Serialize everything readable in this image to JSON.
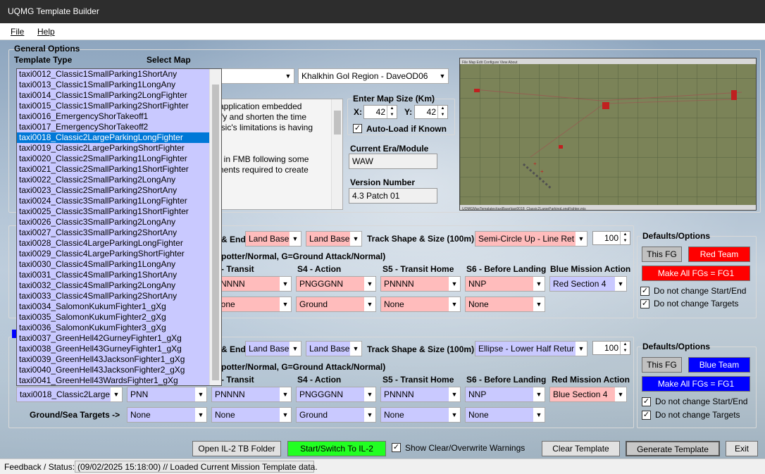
{
  "window": {
    "title": "UQMG Template Builder"
  },
  "menu": {
    "file": "File",
    "help": "Help"
  },
  "general": {
    "group_label": "General Options",
    "template_type_label": "Template Type",
    "select_map_label": "Select Map",
    "map_value": "Khalkhin Gol Region - DaveOD06",
    "desc_lines": [
      "e application embedded",
      "plify and shorten the time",
      "assic's limitations is having",
      "",
      "",
      "on in FMB following some",
      "ements required to create"
    ],
    "map_size_label": "Enter Map Size (Km)",
    "x_label": "X:",
    "x_value": "42",
    "y_label": "Y:",
    "y_value": "42",
    "autoload_label": "Auto-Load if Known",
    "era_label": "Current Era/Module",
    "era_value": "WAW",
    "version_label": "Version Number",
    "version_value": "4.3 Patch 01"
  },
  "dropdown": {
    "selected_index": 6,
    "items": [
      "taxi0012_Classic1SmallParking1ShortAny",
      "taxi0013_Classic1SmallParking1LongAny",
      "taxi0014_Classic1SmallParking2LongFighter",
      "taxi0015_Classic1SmallParking2ShortFighter",
      "taxi0016_EmergencyShorTakeoff1",
      "taxi0017_EmergencyShorTakeoff2",
      "taxi0018_Classic2LargeParkingLongFighter",
      "taxi0019_Classic2LargeParkingShortFighter",
      "taxi0020_Classic2SmallParking1LongFighter",
      "taxi0021_Classic2SmallParking1ShortFighter",
      "taxi0022_Classic2SmallParking2LongAny",
      "taxi0023_Classic2SmallParking2ShortAny",
      "taxi0024_Classic3SmallParking1LongFighter",
      "taxi0025_Classic3SmallParking1ShortFighter",
      "taxi0026_Classic3SmallParking2LongAny",
      "taxi0027_Classic3SmallParking2ShortAny",
      "taxi0028_Classic4LargeParkingLongFighter",
      "taxi0029_Classic4LargeParkingShortFighter",
      "taxi0030_Classic4SmallParking1LongAny",
      "taxi0031_Classic4SmallParking1ShortAny",
      "taxi0032_Classic4SmallParking2LongAny",
      "taxi0033_Classic4SmallParking2ShortAny",
      "taxi0034_SalomonKukumFighter1_gXg",
      "taxi0035_SalomonKukumFighter2_gXg",
      "taxi0036_SalomonKukumFighter3_gXg",
      "taxi0037_GreenHell42GurneyFighter1_gXg",
      "taxi0038_GreenHell43GurneyFighter1_gXg",
      "taxi0039_GreenHell43JacksonFighter1_gXg",
      "taxi0040_GreenHell43JacksonFighter2_gXg",
      "taxi0041_GreenHell43WardsFighter1_gXg"
    ]
  },
  "red": {
    "end_label": "& End:",
    "start_value": "Land Base",
    "end_value": "Land Base",
    "track_label": "Track Shape & Size (100m):",
    "track_value": "Semi-Circle Up - Line Ret",
    "track_size": "100",
    "legend": "potter/Normal, G=Ground Attack/Normal)",
    "col_transit": "- Transit",
    "col_action": "S4 - Action",
    "col_home": "S5 - Transit Home",
    "col_landing": "S6 - Before Landing",
    "col_mission": "Blue Mission Action",
    "row1": [
      "PNNNN",
      "PNGGGNN",
      "PNNNN",
      "NNP",
      "Red Section 4"
    ],
    "row2": [
      "None",
      "Ground",
      "None",
      "None"
    ],
    "defaults_label": "Defaults/Options",
    "this_fg": "This FG",
    "team": "Red Team",
    "make_all": "Make All FGs = FG1",
    "no_change_start": "Do not change Start/End",
    "no_change_targets": "Do not change Targets"
  },
  "blue": {
    "end_label": "& End:",
    "start_value": "Land Base",
    "end_value": "Land Base",
    "track_label": "Track Shape & Size (100m):",
    "track_value": "Ellipse - Lower Half Retur",
    "track_size": "100",
    "legend": "potter/Normal, G=Ground Attack/Normal)",
    "col_transit": "- Transit",
    "col_action": "S4 - Action",
    "col_home": "S5 - Transit Home",
    "col_landing": "S6 - Before Landing",
    "col_mission": "Red Mission Action",
    "template_value": "taxi0018_Classic2Large",
    "row1": [
      "PNN",
      "PNNNN",
      "PNGGGNN",
      "PNNNN",
      "NNP",
      "Blue Section 4"
    ],
    "targets_label": "Ground/Sea Targets ->",
    "row2": [
      "None",
      "None",
      "Ground",
      "None",
      "None"
    ],
    "defaults_label": "Defaults/Options",
    "this_fg": "This FG",
    "team": "Blue Team",
    "make_all": "Make All FGs = FG1",
    "no_change_start": "Do not change Start/End",
    "no_change_targets": "Do not change Targets"
  },
  "bottom": {
    "open_folder": "Open IL-2 TB Folder",
    "start_switch": "Start/Switch To IL-2",
    "show_warnings": "Show Clear/Overwrite Warnings",
    "clear": "Clear Template",
    "generate": "Generate Template",
    "exit": "Exit"
  },
  "status": {
    "label": "Feedback / Status:",
    "message": "(09/02/2025 15:18:00) // Loaded Current Mission Template data."
  },
  "colors": {
    "red_team": "#ff0000",
    "blue_team": "#0000ff",
    "start_button": "#22ff22",
    "pink": "#ffbcbc",
    "lavender": "#c9c9ff",
    "selected": "#0078d7"
  }
}
